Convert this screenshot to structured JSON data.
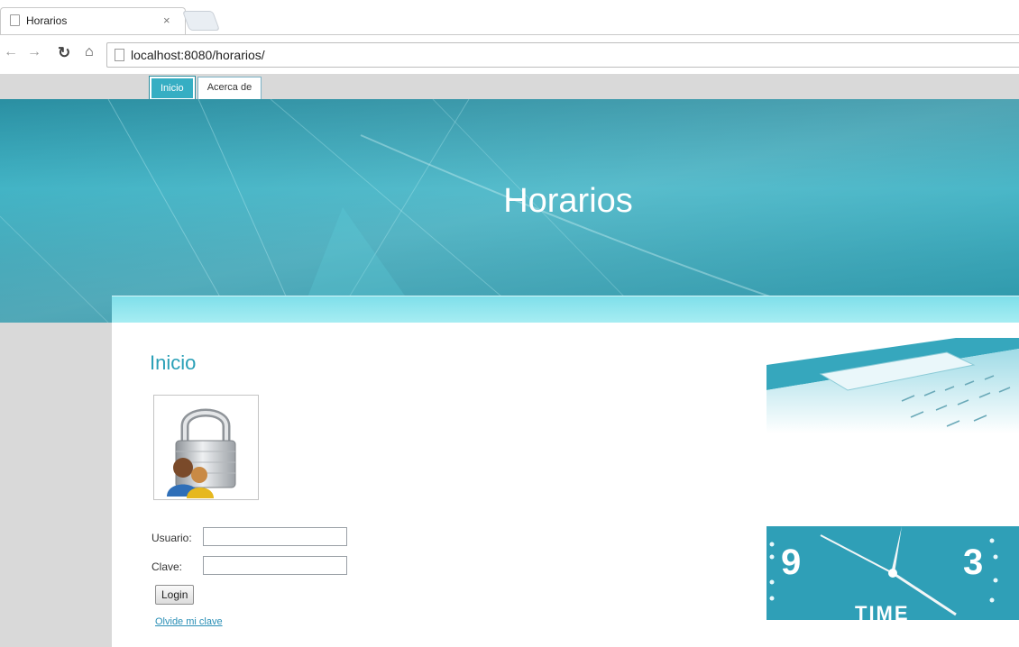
{
  "browser": {
    "tab_title": "Horarios",
    "tab_close_glyph": "×",
    "url": "localhost:8080/horarios/",
    "icons": [
      "back-icon",
      "forward-icon",
      "reload-icon",
      "home-icon",
      "page-icon"
    ]
  },
  "nav": {
    "tabs": [
      {
        "label": "Inicio",
        "active": true
      },
      {
        "label": "Acerca de",
        "active": false
      }
    ]
  },
  "banner": {
    "title": "Horarios"
  },
  "main": {
    "title": "Inicio",
    "login": {
      "user_label": "Usuario:",
      "user_value": "",
      "password_label": "Clave:",
      "password_value": "",
      "button_label": "Login",
      "forgot_link": "Olvide mi clave"
    }
  },
  "side_images": {
    "keyboard": "keyboard-photo",
    "clock": {
      "numbers": [
        "9",
        "3"
      ],
      "caption": "TIME"
    }
  },
  "colors": {
    "accent": "#2aa0b7",
    "banner": "#2e9fb2",
    "strip": "#a9eef3"
  }
}
